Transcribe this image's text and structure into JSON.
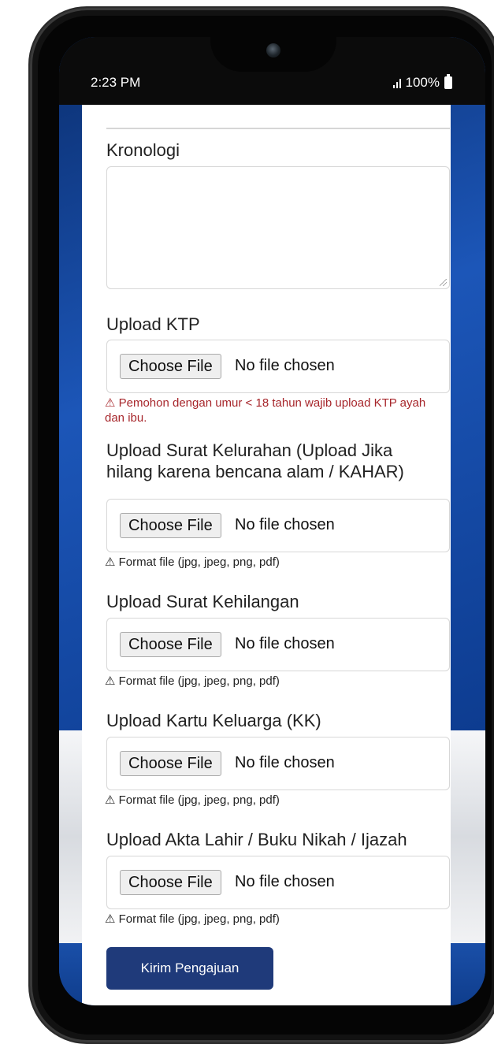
{
  "status_bar": {
    "time": "2:23 PM",
    "battery": "100%"
  },
  "form": {
    "kronologi_label": "Kronologi",
    "kronologi_value": "",
    "ktp": {
      "label": "Upload KTP",
      "button": "Choose File",
      "status": "No file chosen",
      "note": "⚠ Pemohon dengan umur < 18 tahun wajib upload KTP ayah dan ibu."
    },
    "kelurahan": {
      "label_line1": "Upload Surat Kelurahan (Upload Jika",
      "label_line2": "hilang karena bencana alam / KAHAR)",
      "button": "Choose File",
      "status": "No file chosen",
      "note": "⚠ Format file (jpg, jpeg, png, pdf)"
    },
    "kehilangan": {
      "label": "Upload Surat Kehilangan",
      "button": "Choose File",
      "status": "No file chosen",
      "note": "⚠ Format file (jpg, jpeg, png, pdf)"
    },
    "kk": {
      "label": "Upload Kartu Keluarga (KK)",
      "button": "Choose File",
      "status": "No file chosen",
      "note": "⚠ Format file (jpg, jpeg, png, pdf)"
    },
    "akta": {
      "label": "Upload Akta Lahir / Buku Nikah / Ijazah",
      "button": "Choose File",
      "status": "No file chosen",
      "note": "⚠ Format file (jpg, jpeg, png, pdf)"
    },
    "submit_label": "Kirim Pengajuan"
  },
  "colors": {
    "warning": "#a7262b",
    "primary_button": "#1f3a7a",
    "background_blue": "#1c56b8"
  }
}
